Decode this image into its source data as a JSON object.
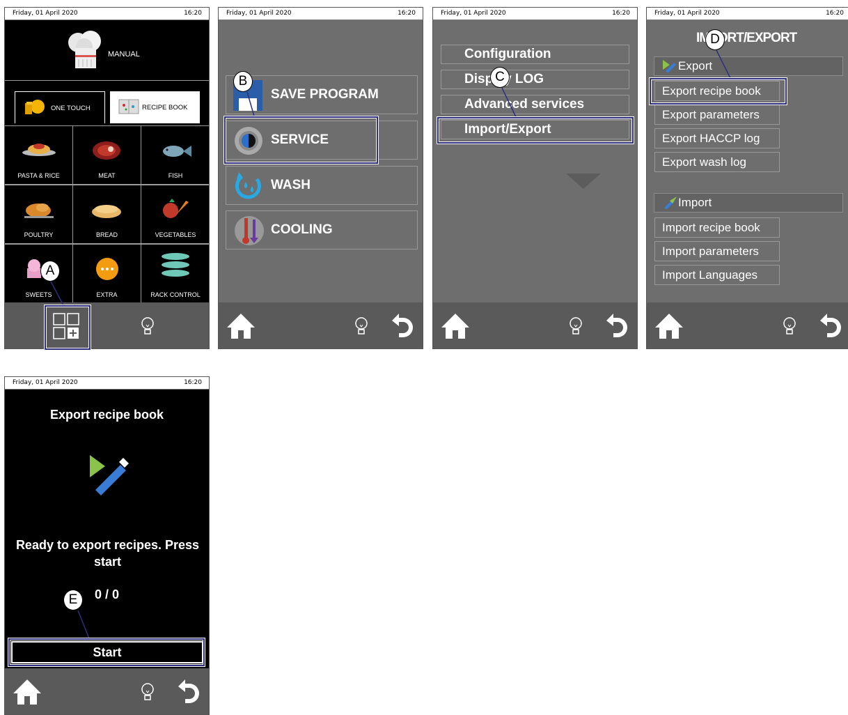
{
  "status": {
    "date": "Friday, 01 April 2020",
    "time": "16:20"
  },
  "screen1": {
    "manual_label": "MANUAL",
    "tabs": [
      {
        "label": "ONE TOUCH"
      },
      {
        "label": "RECIPE BOOK"
      }
    ],
    "categories": [
      {
        "label": "PASTA & RICE",
        "icon": "pasta-icon"
      },
      {
        "label": "MEAT",
        "icon": "meat-icon"
      },
      {
        "label": "FISH",
        "icon": "fish-icon"
      },
      {
        "label": "POULTRY",
        "icon": "poultry-icon"
      },
      {
        "label": "BREAD",
        "icon": "bread-icon"
      },
      {
        "label": "VEGETABLES",
        "icon": "vegetables-icon"
      },
      {
        "label": "SWEETS",
        "icon": "sweets-icon"
      },
      {
        "label": "EXTRA",
        "icon": "extra-icon"
      },
      {
        "label": "RACK CONTROL",
        "icon": "rack-control-icon"
      }
    ]
  },
  "screen2": {
    "items": [
      {
        "label": "SAVE PROGRAM",
        "icon": "save-icon"
      },
      {
        "label": "SERVICE",
        "icon": "gear-icon"
      },
      {
        "label": "WASH",
        "icon": "wash-icon"
      },
      {
        "label": "COOLING",
        "icon": "cooling-icon"
      }
    ]
  },
  "screen3": {
    "items": [
      {
        "label": "Configuration"
      },
      {
        "label": "Display LOG"
      },
      {
        "label": "Advanced services"
      },
      {
        "label": "Import/Export"
      }
    ]
  },
  "screen4": {
    "title": "IMPORT/EXPORT",
    "export_section": "Export",
    "export_items": [
      {
        "label": "Export recipe book"
      },
      {
        "label": "Export parameters"
      },
      {
        "label": "Export HACCP log"
      },
      {
        "label": "Export wash log"
      }
    ],
    "import_section": "Import",
    "import_items": [
      {
        "label": "Import recipe book"
      },
      {
        "label": "Import parameters"
      },
      {
        "label": "Import Languages"
      }
    ]
  },
  "screen5": {
    "title": "Export recipe book",
    "message": "Ready to export recipes. Press start",
    "count": "0 / 0",
    "start_label": "Start"
  },
  "callouts": {
    "a": "A",
    "b": "B",
    "c": "C",
    "d": "D",
    "e": "E"
  },
  "colors": {
    "highlight": "#2d2f7d",
    "panel_gray": "#6e6e6e",
    "bar_gray": "#5a5a5a"
  }
}
